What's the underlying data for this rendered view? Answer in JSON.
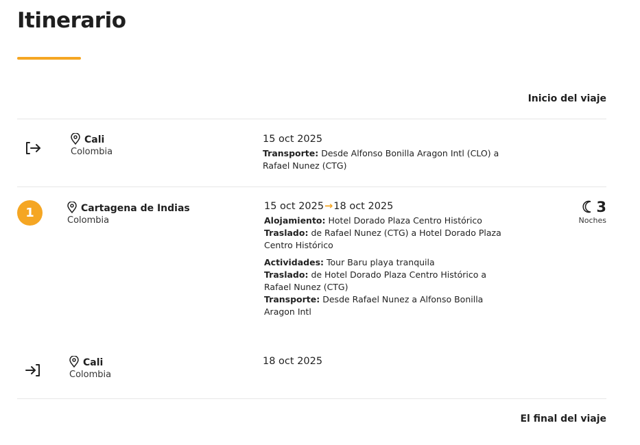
{
  "title": "Itinerario",
  "start_label": "Inicio del viaje",
  "end_label": "El final del viaje",
  "accent_color": "#f5a623",
  "stops": [
    {
      "icon": "arrow-exit-icon",
      "city": "Cali",
      "country": "Colombia",
      "date": "15 oct 2025",
      "details": [
        {
          "key": "Transporte:",
          "value": "Desde Alfonso Bonilla Aragon Intl (CLO) a Rafael Nunez (CTG)"
        }
      ]
    },
    {
      "badge": "1",
      "city": "Cartagena de Indias",
      "country": "Colombia",
      "date_from": "15 oct 2025",
      "date_to": "18 oct 2025",
      "details": [
        {
          "key": "Alojamiento:",
          "value": "Hotel Dorado Plaza Centro Histórico"
        },
        {
          "key": "Traslado:",
          "value": "de Rafael Nunez (CTG) a Hotel Dorado Plaza Centro Histórico"
        },
        {
          "key": "Actividades:",
          "value": "Tour Baru playa tranquila"
        },
        {
          "key": "Traslado:",
          "value": "de Hotel Dorado Plaza Centro Histórico a Rafael Nunez (CTG)"
        },
        {
          "key": "Transporte:",
          "value": "Desde Rafael Nunez a Alfonso Bonilla Aragon Intl"
        }
      ],
      "nights": "3",
      "nights_label": "Noches"
    },
    {
      "icon": "arrow-enter-icon",
      "city": "Cali",
      "country": "Colombia",
      "date": "18 oct 2025",
      "details": []
    }
  ]
}
